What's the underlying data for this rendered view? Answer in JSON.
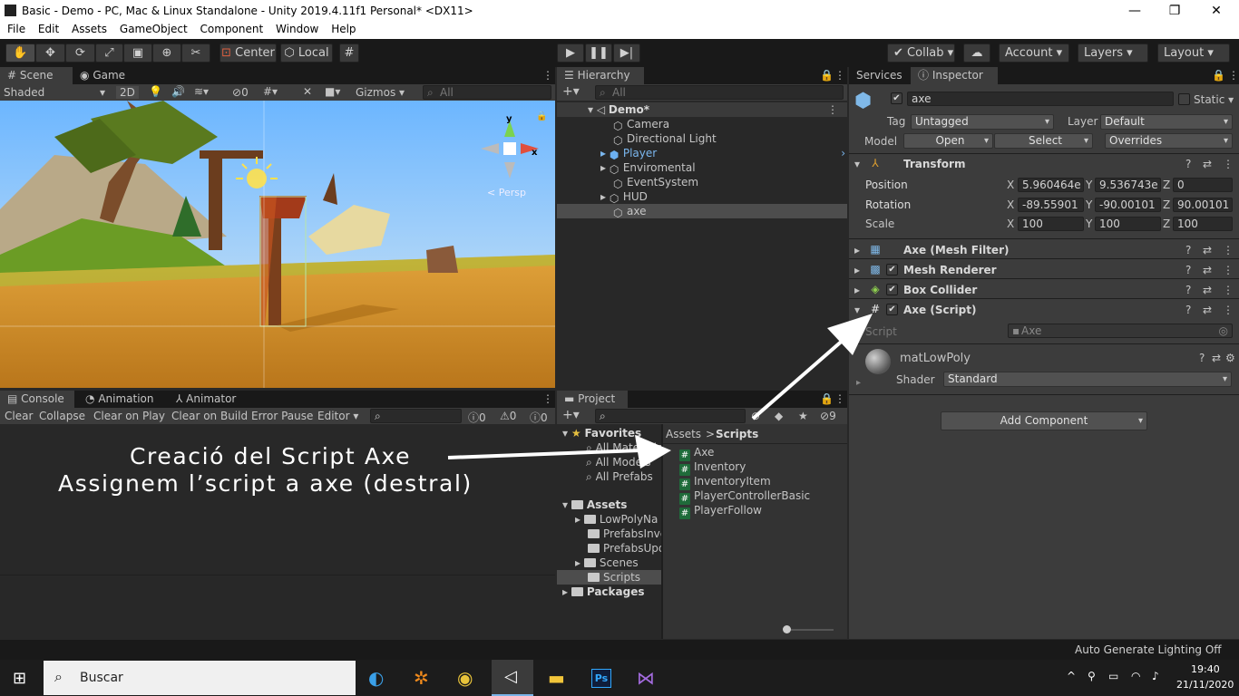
{
  "window": {
    "title": "Basic - Demo - PC, Mac & Linux Standalone - Unity 2019.4.11f1 Personal* <DX11>",
    "minimize": "—",
    "maximize": "❐",
    "close": "✕"
  },
  "menu": [
    "File",
    "Edit",
    "Assets",
    "GameObject",
    "Component",
    "Window",
    "Help"
  ],
  "toolbar": {
    "center": "Center",
    "local": "Local",
    "collab": "Collab",
    "account": "Account",
    "layers": "Layers",
    "layout": "Layout"
  },
  "scene": {
    "tab_scene": "Scene",
    "tab_game": "Game",
    "shading": "Shaded",
    "mode2d": "2D",
    "hidden_count": "0",
    "gizmos": "Gizmos",
    "search_placeholder": "All",
    "persp": "Persp"
  },
  "hierarchy": {
    "tab": "Hierarchy",
    "search_placeholder": "All",
    "root": "Demo*",
    "items": [
      "Camera",
      "Directional Light",
      "Player",
      "Enviromental",
      "EventSystem",
      "HUD",
      "axe"
    ]
  },
  "inspector": {
    "tab_services": "Services",
    "tab_inspector": "Inspector",
    "name": "axe",
    "static": "Static",
    "tag_label": "Tag",
    "tag": "Untagged",
    "layer_label": "Layer",
    "layer": "Default",
    "model_label": "Model",
    "open": "Open",
    "select": "Select",
    "overrides": "Overrides",
    "transform": "Transform",
    "position": "Position",
    "rotation": "Rotation",
    "scale": "Scale",
    "pos": {
      "x": "5.960464e",
      "y": "9.536743e",
      "z": "0"
    },
    "rot": {
      "x": "-89.55901",
      "y": "-90.00101",
      "z": "90.00101"
    },
    "scl": {
      "x": "100",
      "y": "100",
      "z": "100"
    },
    "components": [
      "Axe (Mesh Filter)",
      "Mesh Renderer",
      "Box Collider",
      "Axe (Script)"
    ],
    "script_label": "Script",
    "script_value": "Axe",
    "material": "matLowPoly",
    "shader_label": "Shader",
    "shader": "Standard",
    "add_component": "Add Component",
    "xl": "X",
    "yl": "Y",
    "zl": "Z"
  },
  "console": {
    "tab_console": "Console",
    "tab_animation": "Animation",
    "tab_animator": "Animator",
    "clear": "Clear",
    "collapse": "Collapse",
    "clear_on_play": "Clear on Play",
    "clear_on_build": "Clear on Build",
    "error_pause": "Error Pause",
    "editor": "Editor",
    "logs": "0",
    "warnings": "0",
    "errors": "0"
  },
  "project": {
    "tab": "Project",
    "hidden": "9",
    "favorites": "Favorites",
    "fav_items": [
      "All Materials",
      "All Models",
      "All Prefabs"
    ],
    "assets": "Assets",
    "asset_folders": [
      "LowPolyNa",
      "PrefabsInve",
      "PrefabsUpd",
      "Scenes",
      "Scripts"
    ],
    "packages": "Packages",
    "breadcrumb_root": "Assets",
    "breadcrumb_leaf": "Scripts",
    "scripts": [
      "Axe",
      "Inventory",
      "InventoryItem",
      "PlayerControllerBasic",
      "PlayerFollow"
    ]
  },
  "annotation": {
    "line1": "Creació del Script Axe",
    "line2": "Assignem l’script a axe (destral)"
  },
  "status": {
    "lighting": "Auto Generate Lighting Off"
  },
  "taskbar": {
    "search": "Buscar",
    "time": "19:40",
    "date": "21/11/2020"
  },
  "colors": {
    "accent": "#3a72b0",
    "selection": "#2c5d87",
    "toolbar_bg": "#191919",
    "panel_bg": "#282828"
  }
}
